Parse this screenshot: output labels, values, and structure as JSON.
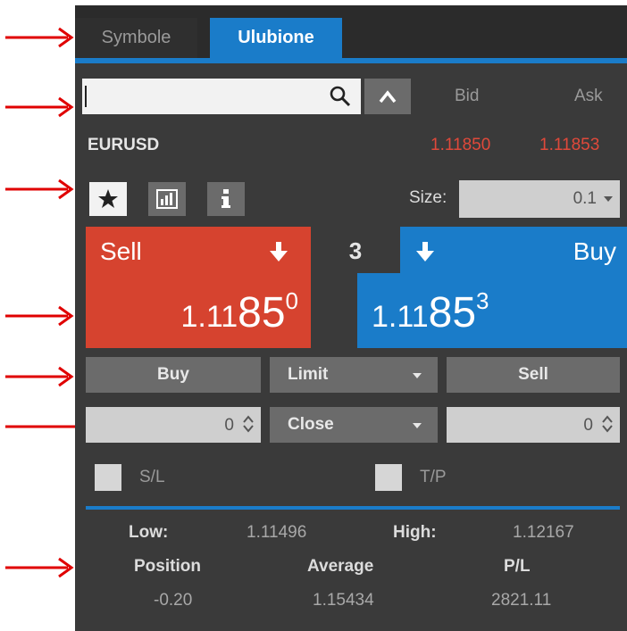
{
  "tabs": {
    "symbols_label": "Symbole",
    "favorites_label": "Ulubione"
  },
  "search": {
    "value": "",
    "placeholder": ""
  },
  "columns": {
    "bid": "Bid",
    "ask": "Ask"
  },
  "instrument": {
    "symbol": "EURUSD",
    "bid": "1.11850",
    "ask": "1.11853"
  },
  "size": {
    "label": "Size:",
    "value": "0.1"
  },
  "sell_panel": {
    "label": "Sell",
    "price_prefix": "1.11",
    "price_main": "85",
    "price_sup": "0"
  },
  "spread": "3",
  "buy_panel": {
    "label": "Buy",
    "price_prefix": "1.11",
    "price_main": "85",
    "price_sup": "3"
  },
  "order": {
    "buy_label": "Buy",
    "type_label": "Limit",
    "sell_label": "Sell",
    "close_label": "Close",
    "left_qty": "0",
    "right_qty": "0"
  },
  "checkboxes": {
    "sl_label": "S/L",
    "tp_label": "T/P"
  },
  "stats": {
    "low_label": "Low:",
    "low_value": "1.11496",
    "high_label": "High:",
    "high_value": "1.12167",
    "position_label": "Position",
    "average_label": "Average",
    "pl_label": "P/L",
    "position_value": "-0.20",
    "average_value": "1.15434",
    "pl_value": "2821.11"
  },
  "colors": {
    "sell": "#d6432f",
    "buy": "#1a7cc9",
    "panel": "#3a3a3a",
    "annotation_arrow": "#e00000"
  }
}
